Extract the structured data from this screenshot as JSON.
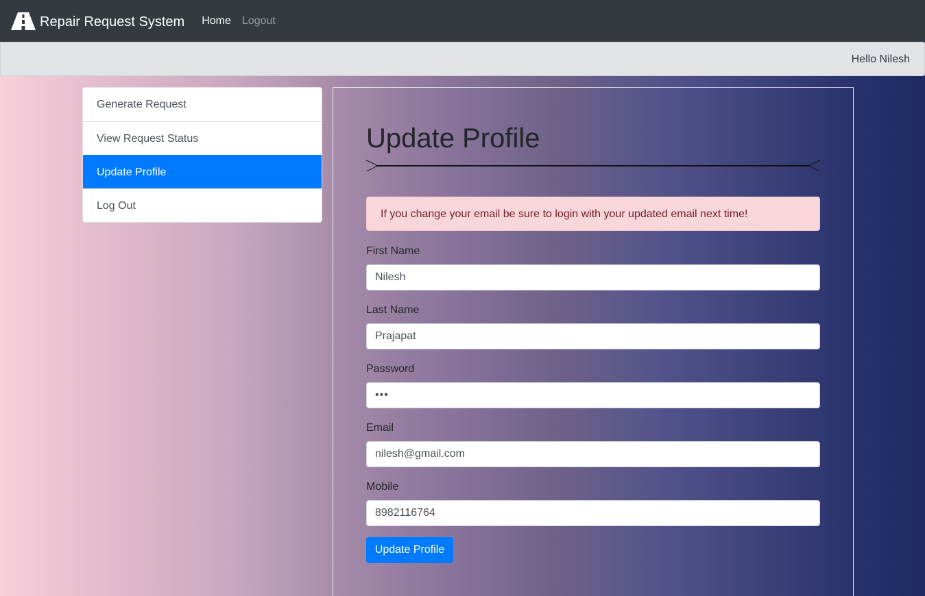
{
  "navbar": {
    "brand_icon": "road-icon",
    "brand": "Repair Request System",
    "links": [
      {
        "label": "Home",
        "active": true
      },
      {
        "label": "Logout",
        "active": false
      }
    ]
  },
  "subbar": {
    "greeting": "Hello Nilesh"
  },
  "sidebar": {
    "items": [
      {
        "label": "Generate Request",
        "active": false
      },
      {
        "label": "View Request Status",
        "active": false
      },
      {
        "label": "Update Profile",
        "active": true
      },
      {
        "label": "Log Out",
        "active": false
      }
    ]
  },
  "main": {
    "title": "Update Profile",
    "alert": "If you change your email be sure to login with your updated email next time!",
    "fields": {
      "first_name": {
        "label": "First Name",
        "value": "Nilesh"
      },
      "last_name": {
        "label": "Last Name",
        "value": "Prajapat"
      },
      "password": {
        "label": "Password",
        "value": "•••"
      },
      "email": {
        "label": "Email",
        "value": "nilesh@gmail.com"
      },
      "mobile": {
        "label": "Mobile",
        "value": "8982116764"
      }
    },
    "submit_label": "Update Profile"
  },
  "colors": {
    "navbar": "#343a40",
    "primary": "#007bff",
    "alert_bg": "#f8d7da",
    "alert_text": "#721c24"
  }
}
